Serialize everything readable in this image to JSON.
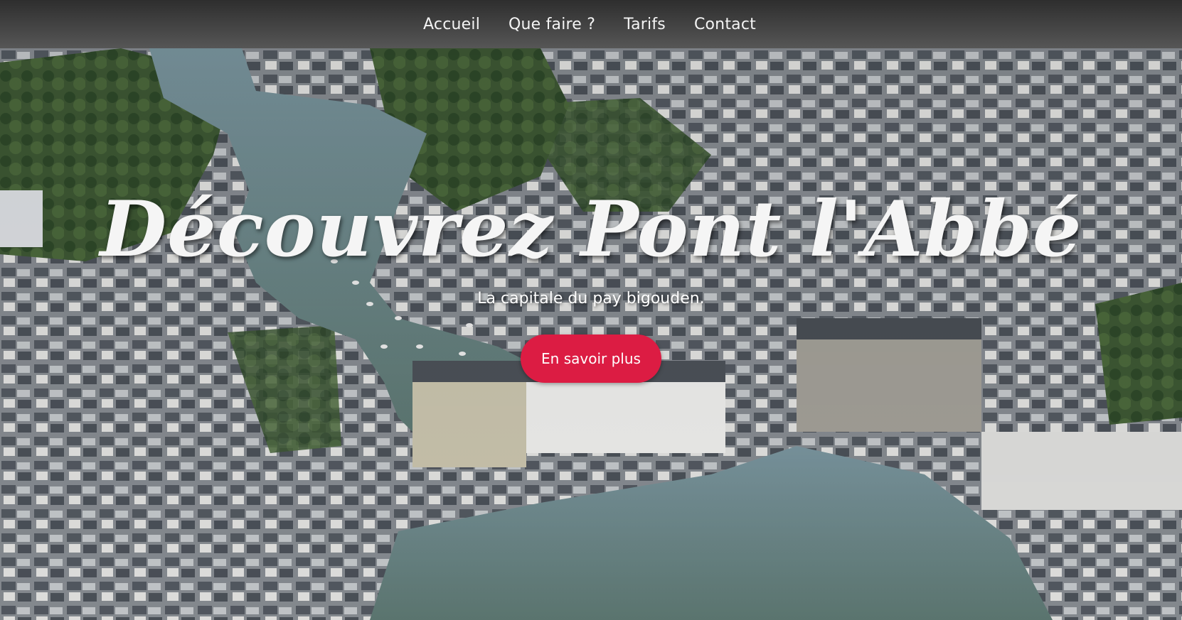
{
  "nav": {
    "items": [
      {
        "label": "Accueil"
      },
      {
        "label": "Que faire ?"
      },
      {
        "label": "Tarifs"
      },
      {
        "label": "Contact"
      }
    ]
  },
  "hero": {
    "title": "Découvrez Pont l'Abbé",
    "subtitle": "La capitale du pay bigouden.",
    "button_label": "En savoir plus",
    "image": "aerial-photo-of-town-harbour"
  },
  "colors": {
    "nav_bg": "#3a3a3a",
    "accent_button": "#dc1c43",
    "water": "#6d8a8f",
    "roof": "#5b6068"
  }
}
